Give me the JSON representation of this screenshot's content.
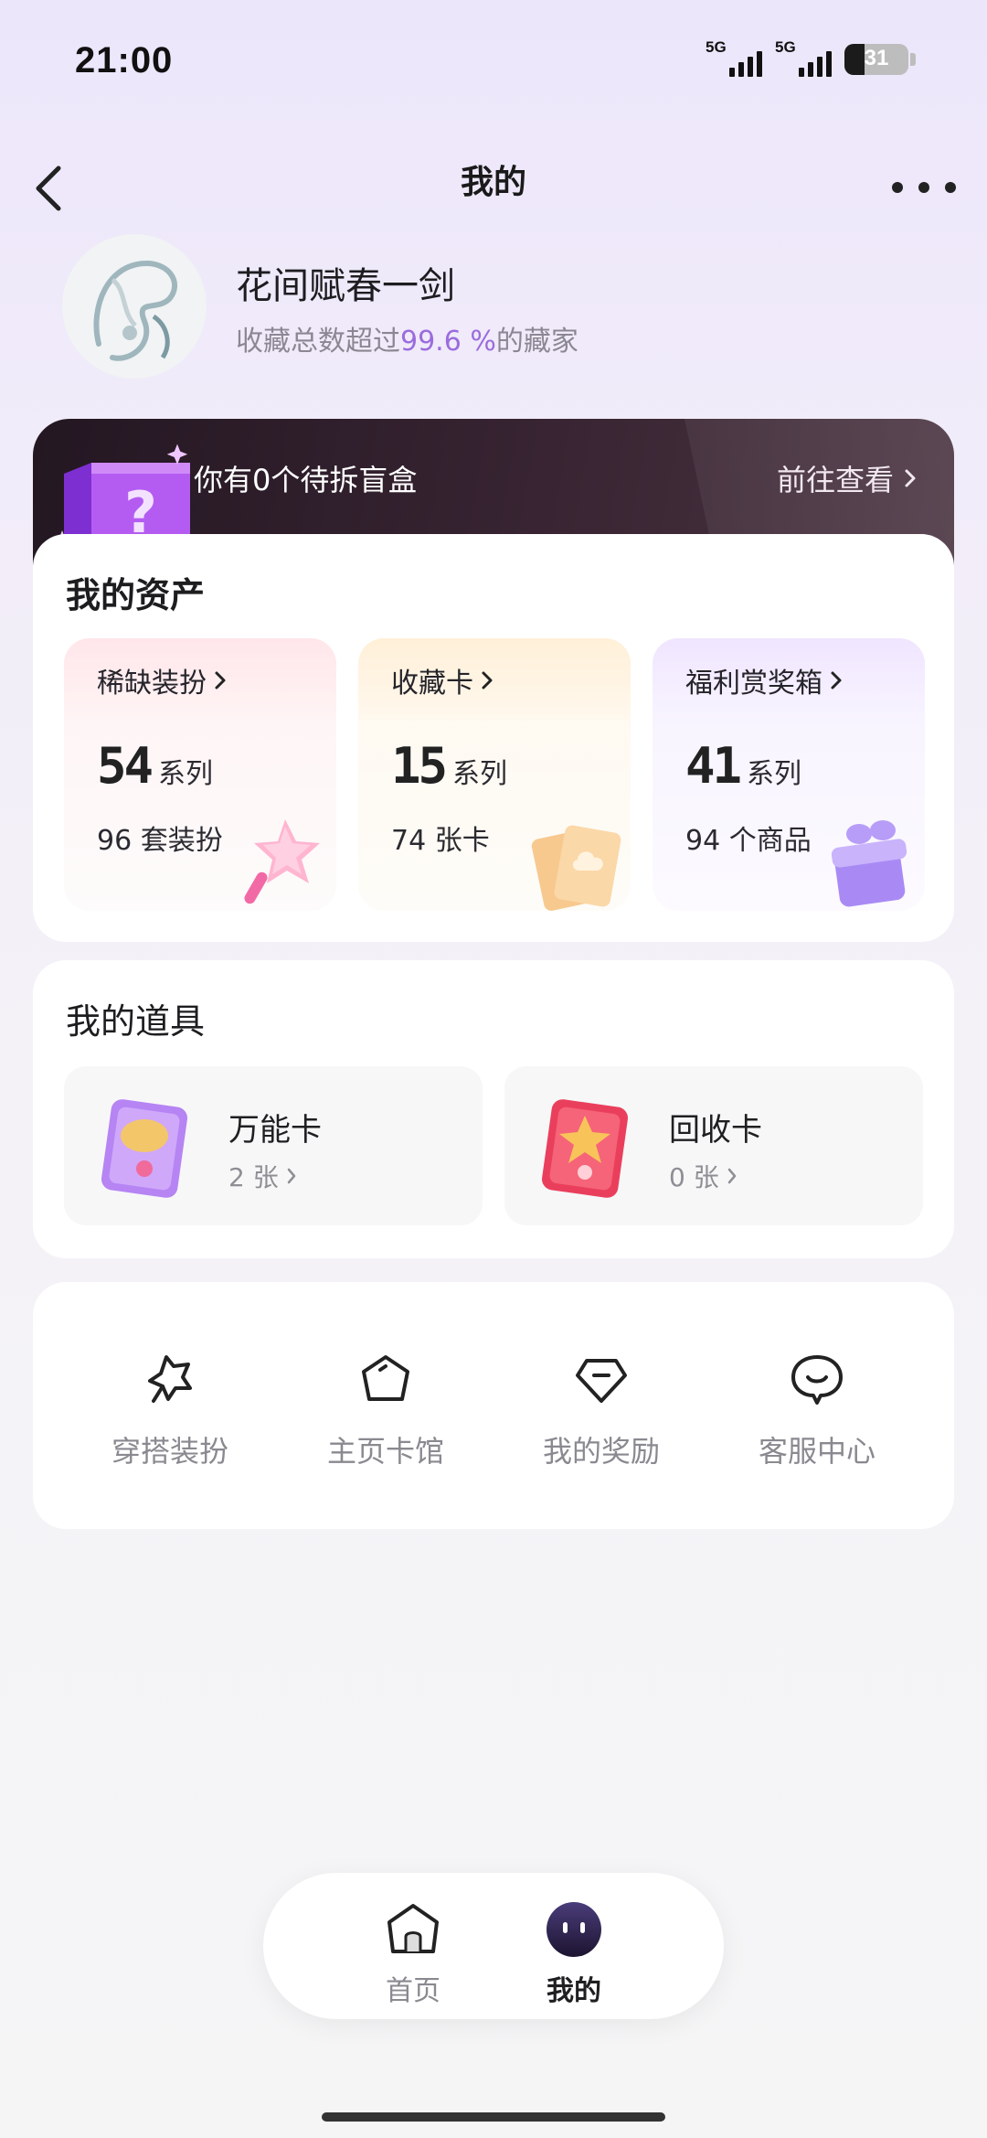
{
  "status_bar": {
    "time": "21:00",
    "network1": "5G",
    "network2": "5G",
    "battery_level": "31"
  },
  "nav": {
    "title": "我的"
  },
  "profile": {
    "nickname": "花间赋春一剑",
    "rank_prefix": "收藏总数超过",
    "rank_percent": "99.6 %",
    "rank_suffix": "的藏家"
  },
  "blind_box": {
    "text": "你有0个待拆盲盒",
    "link": "前往查看"
  },
  "assets": {
    "title": "我的资产",
    "cards": [
      {
        "name": "稀缺装扮",
        "count": "54",
        "unit": "系列",
        "sub": "96 套装扮"
      },
      {
        "name": "收藏卡",
        "count": "15",
        "unit": "系列",
        "sub": "74 张卡"
      },
      {
        "name": "福利赏奖箱",
        "count": "41",
        "unit": "系列",
        "sub": "94 个商品"
      }
    ]
  },
  "props": {
    "title": "我的道具",
    "items": [
      {
        "name": "万能卡",
        "count": "2 张"
      },
      {
        "name": "回收卡",
        "count": "0 张"
      }
    ]
  },
  "shortcuts": [
    {
      "label": "穿搭装扮",
      "icon": "outfit-icon"
    },
    {
      "label": "主页卡馆",
      "icon": "pentagon-icon"
    },
    {
      "label": "我的奖励",
      "icon": "diamond-icon"
    },
    {
      "label": "客服中心",
      "icon": "chat-icon"
    }
  ],
  "tabbar": {
    "home": "首页",
    "mine": "我的"
  },
  "colors": {
    "accent_purple": "#9b6cdd",
    "banner_dark": "#2c1c28"
  }
}
